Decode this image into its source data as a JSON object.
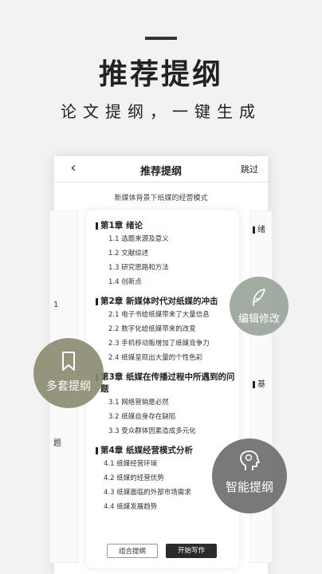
{
  "hero": {
    "title": "推荐提纲",
    "subtitle": "论文提纲，一键生成"
  },
  "app": {
    "back_icon": "chevron-left-icon",
    "title": "推荐提纲",
    "skip_label": "跳过",
    "doc_title": "新媒体背景下纸媒的经营模式"
  },
  "side_left": {
    "items": [
      "1",
      "题"
    ]
  },
  "side_right": {
    "items": [
      "绪",
      "基"
    ]
  },
  "outline": {
    "chapters": [
      {
        "title": "第1章 绪论",
        "sections": [
          "1.1 选题来源及意义",
          "1.2 文献综述",
          "1.3 研究思路和方法",
          "1.4 创新点"
        ]
      },
      {
        "title": "第2章 新媒体时代对纸媒的冲击",
        "sections": [
          "2.1 电子书给纸媒带来了大量信息",
          "2.2 数字化给纸媒带来的改变",
          "2.3 手机移动贩增加了纸媒竞争力",
          "2.4 纸媒呈现出大量的个性色彩"
        ]
      },
      {
        "title": "第3章 纸媒在传播过程中所遇到的问题",
        "sections": [
          "3.1 网络营销是必然",
          "3.2 纸媒自身存在缺陷",
          "3.3 受众群体因素造成多元化"
        ]
      },
      {
        "title": "第4章 纸媒经营模式分析",
        "sections": [
          "4.1 纸媒经营环境",
          "4.2 纸媒的经营优势",
          "4.3 纸媒面临的外部市场需求",
          "4.4 纸媒发展趋势"
        ]
      }
    ],
    "combine_label": "组合提纲",
    "start_label": "开始写作"
  },
  "bubbles": {
    "edit": {
      "label": "编辑修改",
      "icon": "feather-icon"
    },
    "multi": {
      "label": "多套提纲",
      "icon": "bookmark-icon"
    },
    "smart": {
      "label": "智能提纲",
      "icon": "brain-head-icon"
    }
  }
}
